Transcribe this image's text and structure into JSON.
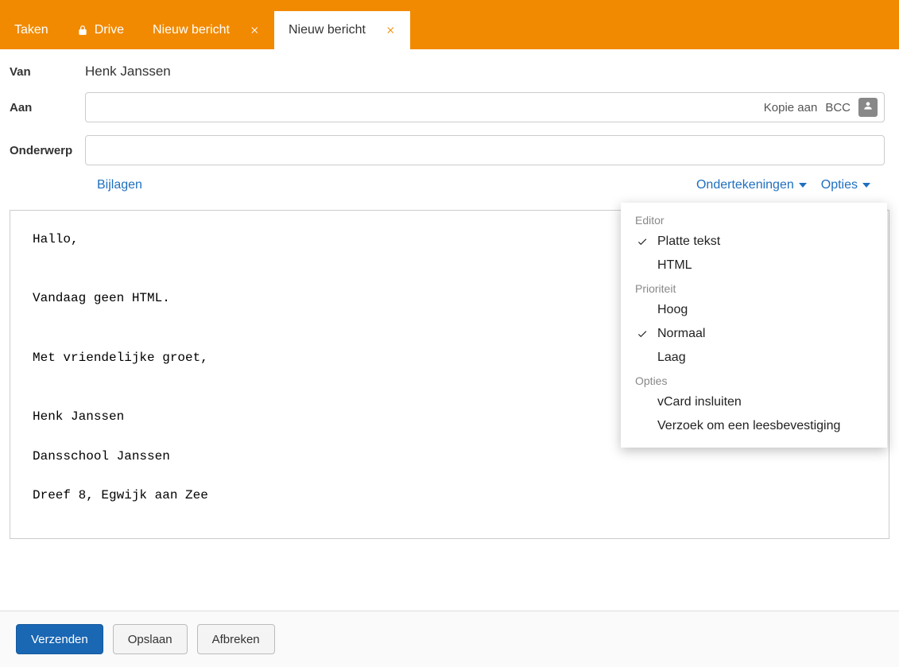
{
  "tabs": {
    "taken": "Taken",
    "drive": "Drive",
    "new1": "Nieuw bericht",
    "new2": "Nieuw bericht"
  },
  "compose": {
    "from_label": "Van",
    "from_value": "Henk Janssen",
    "to_label": "Aan",
    "cc_label": "Kopie aan",
    "bcc_label": "BCC",
    "subject_label": "Onderwerp",
    "attachments": "Bijlagen",
    "signatures": "Ondertekeningen",
    "options": "Opties",
    "body": "Hallo,\n\n\nVandaag geen HTML.\n\n\nMet vriendelijke groet,\n\n\nHenk Janssen\n\nDansschool Janssen\n\nDreef 8, Egwijk aan Zee"
  },
  "opts_menu": {
    "editor_header": "Editor",
    "plain": "Platte tekst",
    "html": "HTML",
    "priority_header": "Prioriteit",
    "high": "Hoog",
    "normal": "Normaal",
    "low": "Laag",
    "opts_header": "Opties",
    "vcard": "vCard insluiten",
    "receipt": "Verzoek om een leesbevestiging"
  },
  "footer": {
    "send": "Verzenden",
    "save": "Opslaan",
    "cancel": "Afbreken"
  }
}
